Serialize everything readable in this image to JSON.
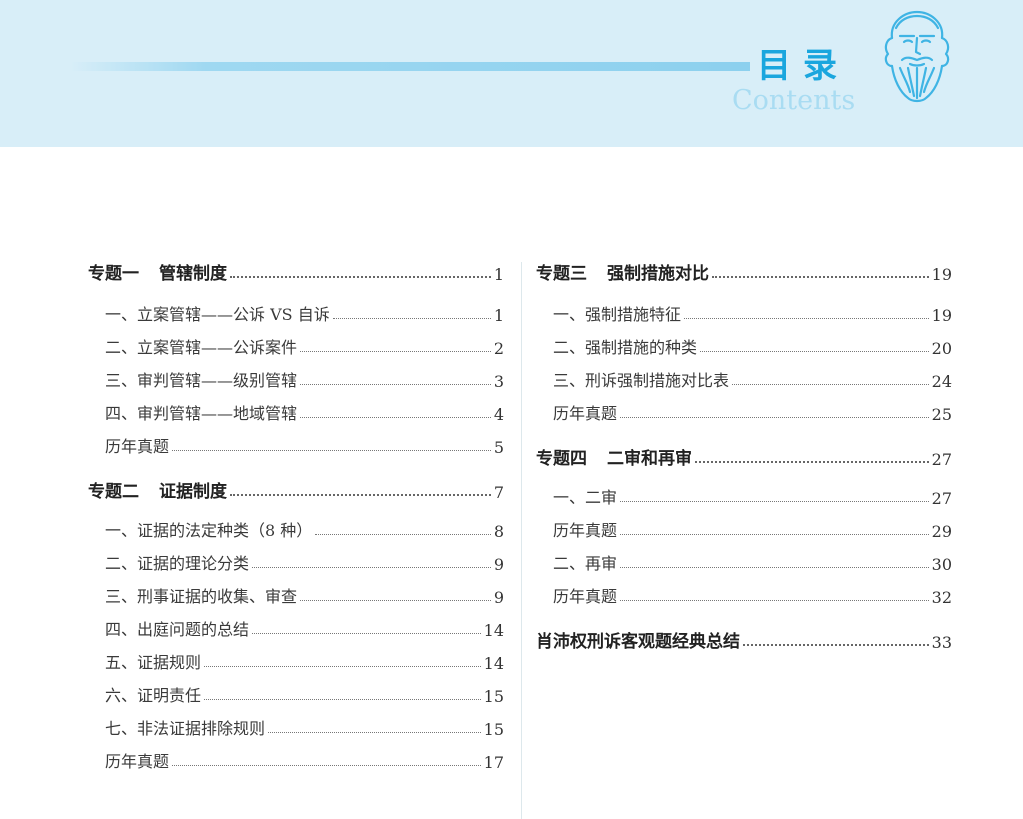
{
  "header": {
    "title_zh": "目录",
    "title_en": "Contents",
    "colors": {
      "band": "#d8eef8",
      "title": "#1aa6de",
      "subtitle": "#a9dcf2"
    },
    "logo_icon": "bearded-philosopher-face-icon"
  },
  "toc": {
    "left": [
      {
        "type": "major",
        "num": "专题一",
        "title": "管辖制度",
        "page": "1"
      },
      {
        "type": "minor",
        "title": "一、立案管辖——公诉 VS 自诉",
        "page": "1"
      },
      {
        "type": "minor",
        "title": "二、立案管辖——公诉案件",
        "page": "2"
      },
      {
        "type": "minor",
        "title": "三、审判管辖——级别管辖",
        "page": "3"
      },
      {
        "type": "minor",
        "title": "四、审判管辖——地域管辖",
        "page": "4"
      },
      {
        "type": "minor",
        "title": "历年真题",
        "page": "5"
      },
      {
        "type": "major",
        "num": "专题二",
        "title": "证据制度",
        "page": "7"
      },
      {
        "type": "minor",
        "title": "一、证据的法定种类（8 种）",
        "page": "8"
      },
      {
        "type": "minor",
        "title": "二、证据的理论分类",
        "page": "9"
      },
      {
        "type": "minor",
        "title": "三、刑事证据的收集、审查",
        "page": "9"
      },
      {
        "type": "minor",
        "title": "四、出庭问题的总结",
        "page": "14"
      },
      {
        "type": "minor",
        "title": "五、证据规则",
        "page": "14"
      },
      {
        "type": "minor",
        "title": "六、证明责任",
        "page": "15"
      },
      {
        "type": "minor",
        "title": "七、非法证据排除规则",
        "page": "15"
      },
      {
        "type": "minor",
        "title": "历年真题",
        "page": "17"
      }
    ],
    "right": [
      {
        "type": "major",
        "num": "专题三",
        "title": "强制措施对比",
        "page": "19"
      },
      {
        "type": "minor",
        "title": "一、强制措施特征",
        "page": "19"
      },
      {
        "type": "minor",
        "title": "二、强制措施的种类",
        "page": "20"
      },
      {
        "type": "minor",
        "title": "三、刑诉强制措施对比表",
        "page": "24"
      },
      {
        "type": "minor",
        "title": "历年真题",
        "page": "25"
      },
      {
        "type": "major",
        "num": "专题四",
        "title": "二审和再审",
        "page": "27"
      },
      {
        "type": "minor",
        "title": "一、二审",
        "page": "27"
      },
      {
        "type": "minor",
        "title": "历年真题",
        "page": "29"
      },
      {
        "type": "minor",
        "title": "二、再审",
        "page": "30"
      },
      {
        "type": "minor",
        "title": "历年真题",
        "page": "32"
      },
      {
        "type": "major",
        "num": "",
        "title": "肖沛权刑诉客观题经典总结",
        "page": "33"
      }
    ]
  }
}
